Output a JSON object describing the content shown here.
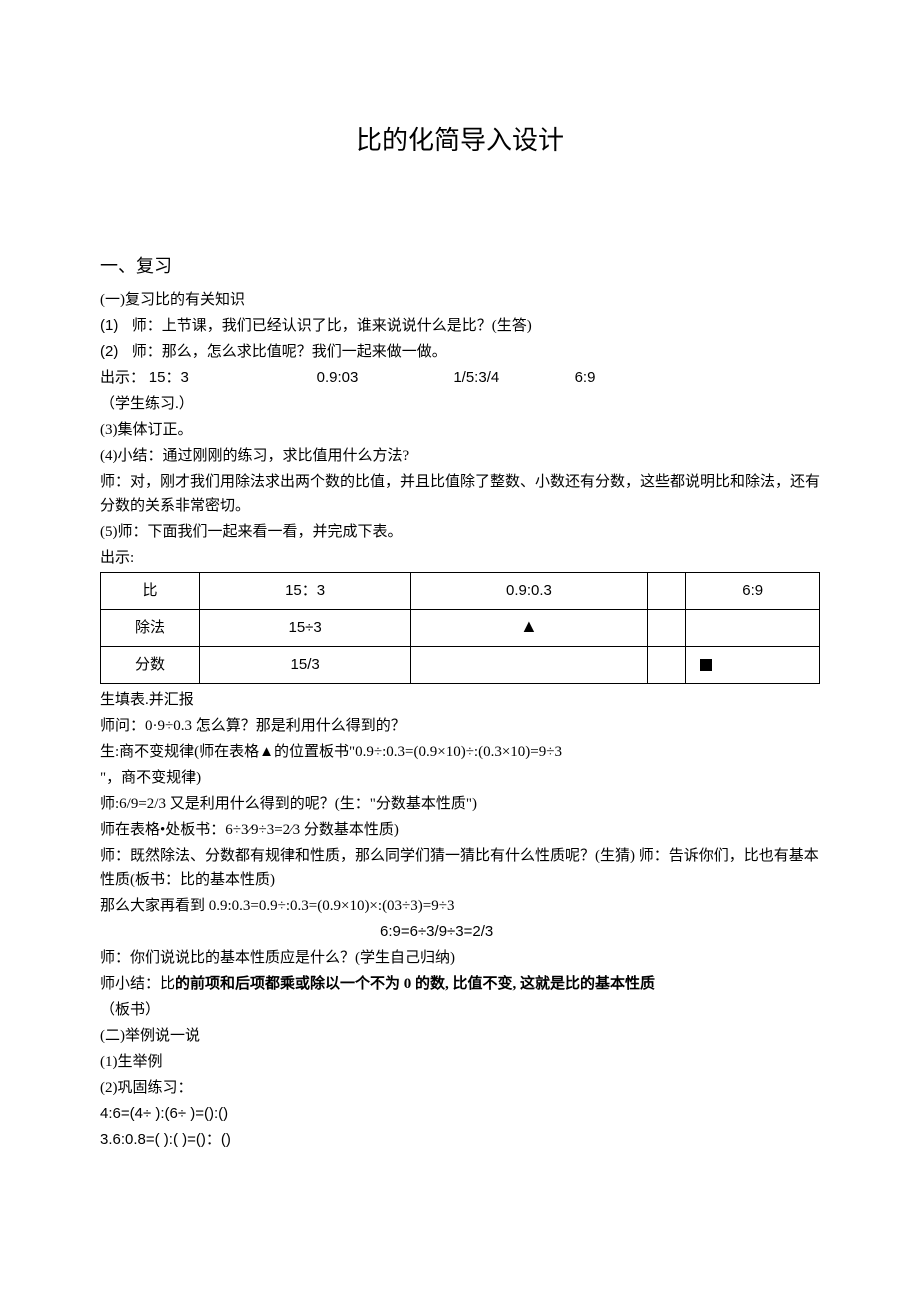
{
  "title": "比的化简导入设计",
  "section1": {
    "heading": "一、复习",
    "part1_heading": "(一)复习比的有关知识",
    "item1_num": "(1)",
    "item1_text": "师：上节课，我们已经认识了比，谁来说说什么是比？(生答)",
    "item2_num": "(2)",
    "item2_text": "师：那么，怎么求比值呢？我们一起来做一做。",
    "display_label": "出示：",
    "display_a": "15：3",
    "display_b": "0.9:03",
    "display_c": "1/5:3/4",
    "display_d": "6:9",
    "display_note": "（学生练习.）",
    "item3": "(3)集体订正。",
    "item4": "(4)小结：通过刚刚的练习，求比值用什么方法?",
    "item4_note": "师：对，刚才我们用除法求出两个数的比值，并且比值除了整数、小数还有分数，这些都说明比和除法，还有分数的关系非常密切。",
    "item5": "(5)师：下面我们一起来看一看，并完成下表。",
    "item5_label": "出示:",
    "table": {
      "r1": {
        "h": "比",
        "c1": "15：3",
        "c2": "0.9:0.3",
        "c3": "",
        "c4": "6:9"
      },
      "r2": {
        "h": "除法",
        "c1": "15÷3"
      },
      "r3": {
        "h": "分数",
        "c1": "15/3"
      }
    },
    "after_table": {
      "l1": "生填表.并汇报",
      "l2": "师问：0·9÷0.3 怎么算？那是利用什么得到的？",
      "l3": "生:商不变规律(师在表格▲的位置板书\"0.9÷:0.3=(0.9×10)÷:(0.3×10)=9÷3",
      "l3b": "\"，商不变规律)",
      "l4": "师:6/9=2/3 又是利用什么得到的呢？(生：\"分数基本性质\")",
      "l5": "师在表格•处板书：6÷3⁄9÷3=2⁄3 分数基本性质)",
      "l6": "师：既然除法、分数都有规律和性质，那么同学们猜一猜比有什么性质呢？(生猜) 师：告诉你们，比也有基本性质(板书：比的基本性质)",
      "l7": "那么大家再看到 0.9:0.3=0.9÷:0.3=(0.9×10)×:(03÷3)=9÷3",
      "l8": "6:9=6÷3/9÷3=2/3",
      "l9": "师：你们说说比的基本性质应是什么？(学生自己归纳)",
      "l10_pre": "师小结：比",
      "l10_bold": "的前项和后项都乘或除以一个不为 0 的数, 比值不变, 这就是比的基本性质",
      "l11": "（板书）"
    },
    "part2_heading": "(二)举例说一说",
    "ex1": "(1)生举例",
    "ex2": "(2)巩固练习：",
    "ex_line1": "4:6=(4÷        ):(6÷        )=():()",
    "ex_line2": "3.6:0.8=(         ):(          )=()：()"
  }
}
